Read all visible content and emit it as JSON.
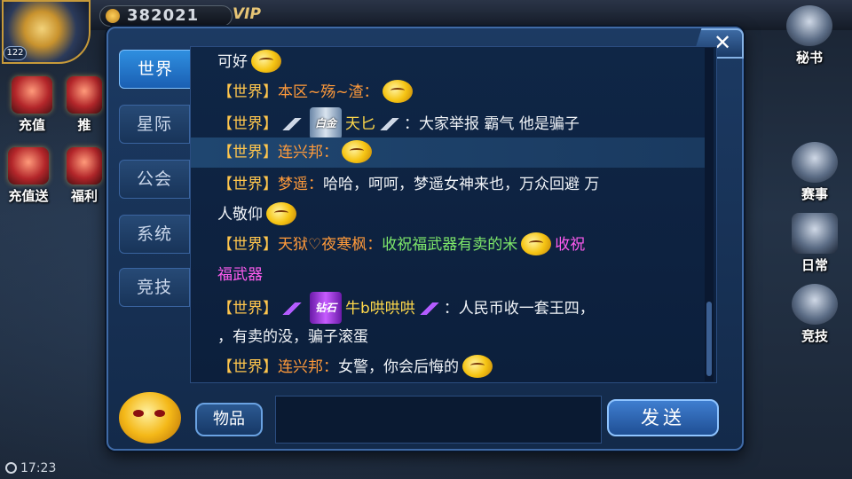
{
  "hud": {
    "gold": "382021",
    "vip": "VIP",
    "level": "122",
    "time": "17:23",
    "left_icons": [
      "充值",
      "推",
      "充值送",
      "福利"
    ],
    "right_icons": [
      "秘书",
      "赛事",
      "日常",
      "竞技"
    ]
  },
  "dialog": {
    "title": "",
    "close_label": "✕",
    "tabs": [
      "世界",
      "星际",
      "公会",
      "系统",
      "竞技"
    ],
    "active_tab": "世界",
    "items_button": "物品",
    "send_button": "发送",
    "input_placeholder": ""
  },
  "messages": [
    {
      "channel": "",
      "sender": "",
      "text": "可好"
    },
    {
      "channel": "【世界】",
      "sender": "本区~殇~渣：",
      "text": ""
    },
    {
      "channel": "【世界】",
      "badge": "白金",
      "sender": "天匕",
      "text": "：大家举报 霸气 他是骗子"
    },
    {
      "channel": "【世界】",
      "sender": "连兴邦：",
      "text": ""
    },
    {
      "channel": "【世界】",
      "sender": "梦遥：",
      "text": "哈哈，呵呵，梦遥女神来也，万众回避 万",
      "text2": "人敬仰"
    },
    {
      "channel": "【世界】",
      "sender": "天狱♡夜寒枫：",
      "text": "收祝福武器有卖的米",
      "text_pink": "收祝",
      "text2": "福武器"
    },
    {
      "channel": "【世界】",
      "badge": "钻石",
      "sender": "牛b哄哄哄",
      "text": "：人民币收一套王四，",
      "text2": "，有卖的没，骗子滚蛋"
    },
    {
      "channel": "【世界】",
      "sender": "连兴邦：",
      "text": "女警，你会后悔的"
    }
  ]
}
